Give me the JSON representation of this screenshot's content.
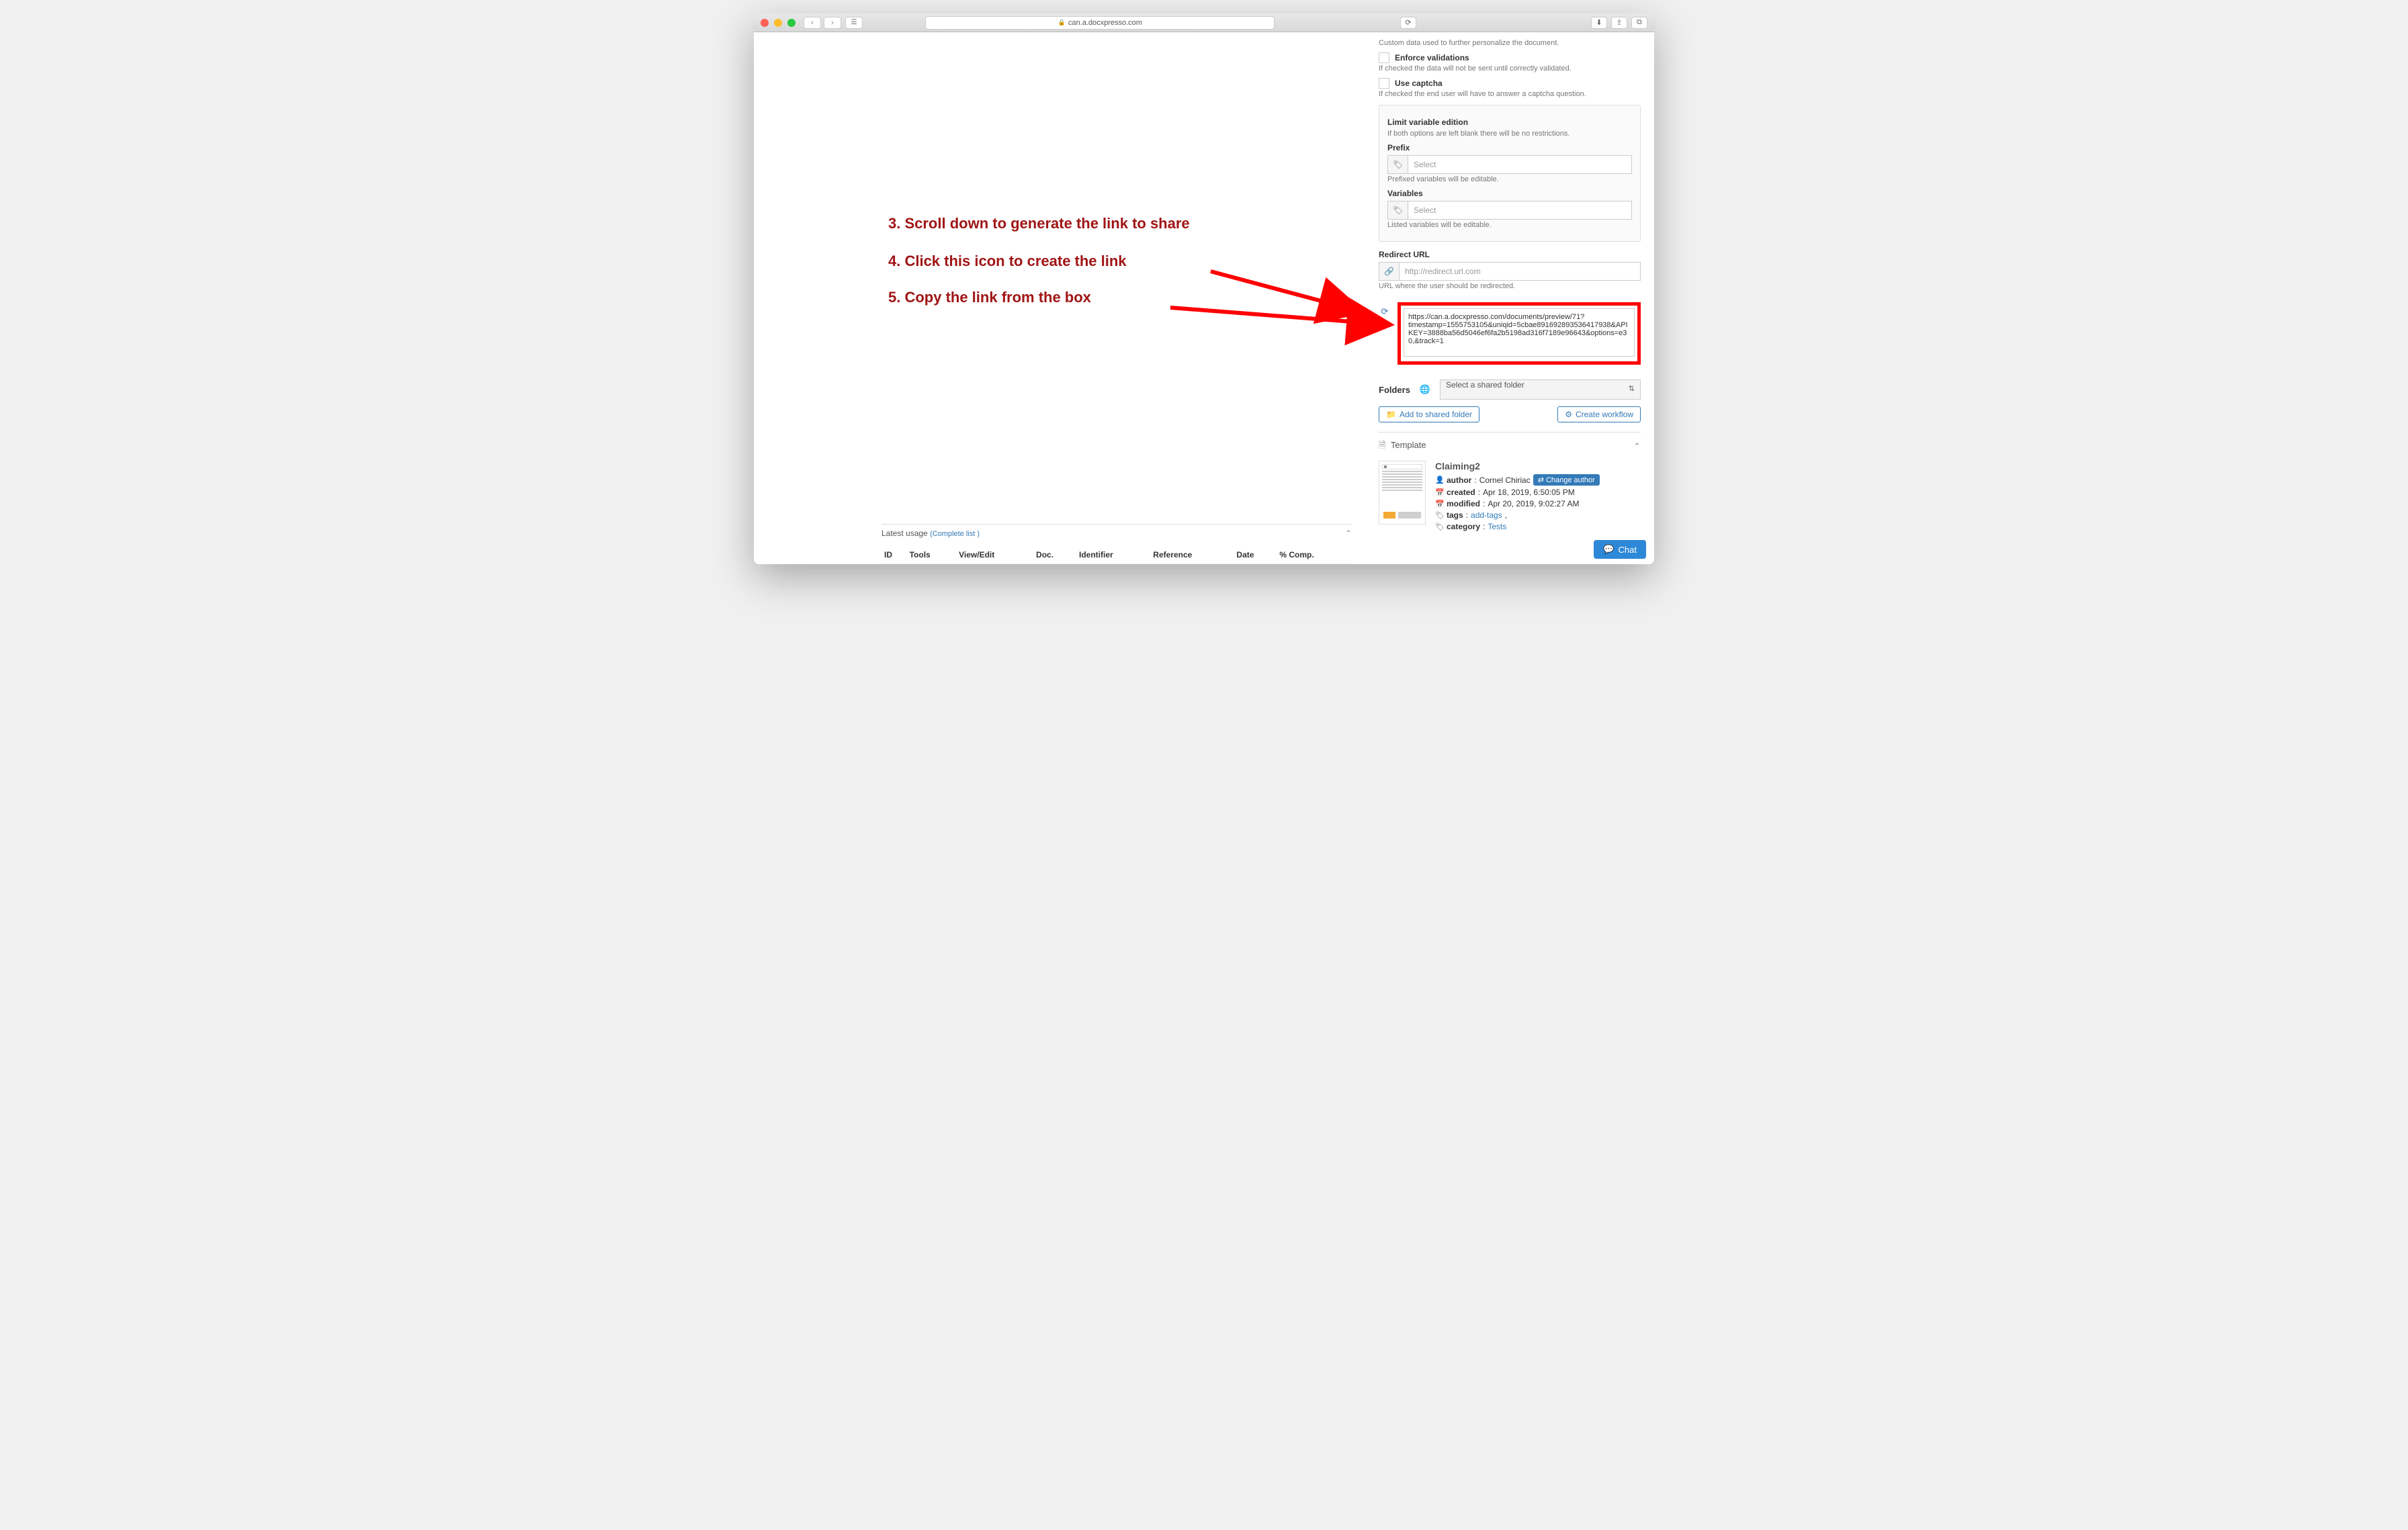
{
  "browser": {
    "url": "can.a.docxpresso.com"
  },
  "annotations": {
    "step3": "3. Scroll down to generate the link to share",
    "step4": "4. Click this icon to create the link",
    "step5": "5. Copy the link from the box"
  },
  "settings": {
    "custom_data_help": "Custom data used to further personalize the document.",
    "enforce_label": "Enforce validations",
    "enforce_help": "If checked the data will not be sent until correctly validated.",
    "captcha_label": "Use captcha",
    "captcha_help": "If checked the end user will have to answer a captcha question.",
    "limit_title": "Limit variable edition",
    "limit_help": "If both options are left blank there will be no restrictions.",
    "prefix_label": "Prefix",
    "prefix_placeholder": "Select",
    "prefix_help": "Prefixed variables will be editable.",
    "variables_label": "Variables",
    "variables_placeholder": "Select",
    "variables_help": "Listed variables will be editable.",
    "redirect_label": "Redirect URL",
    "redirect_placeholder": "http://redirect.url.com",
    "redirect_help": "URL where the user should be redirected.",
    "generated_link": "https://can.a.docxpresso.com/documents/preview/71?timestamp=1555753105&uniqid=5cbae891692893536417938&APIKEY=3888ba56d5046ef6fa2b5198ad316f7189e96643&options=e30,&track=1",
    "folders_label": "Folders",
    "folders_placeholder": "Select a shared folder",
    "add_folder_btn": "Add to shared folder",
    "create_workflow_btn": "Create workflow"
  },
  "template": {
    "section_title": "Template",
    "title": "Claiming2",
    "author_label": "author",
    "author_value": "Cornel Chiriac",
    "change_author_btn": "Change author",
    "created_label": "created",
    "created_value": "Apr 18, 2019, 6:50:05 PM",
    "modified_label": "modified",
    "modified_value": "Apr 20, 2019, 9:02:27 AM",
    "tags_label": "tags",
    "tags_value": "add-tags",
    "category_label": "category",
    "category_value": "Tests"
  },
  "latest": {
    "title": "Latest usage",
    "complete_list": "(Complete list )",
    "columns": [
      "ID",
      "Tools",
      "View/Edit",
      "Doc.",
      "Identifier",
      "Reference",
      "Date",
      "% Comp."
    ]
  },
  "chat": {
    "label": "Chat"
  }
}
